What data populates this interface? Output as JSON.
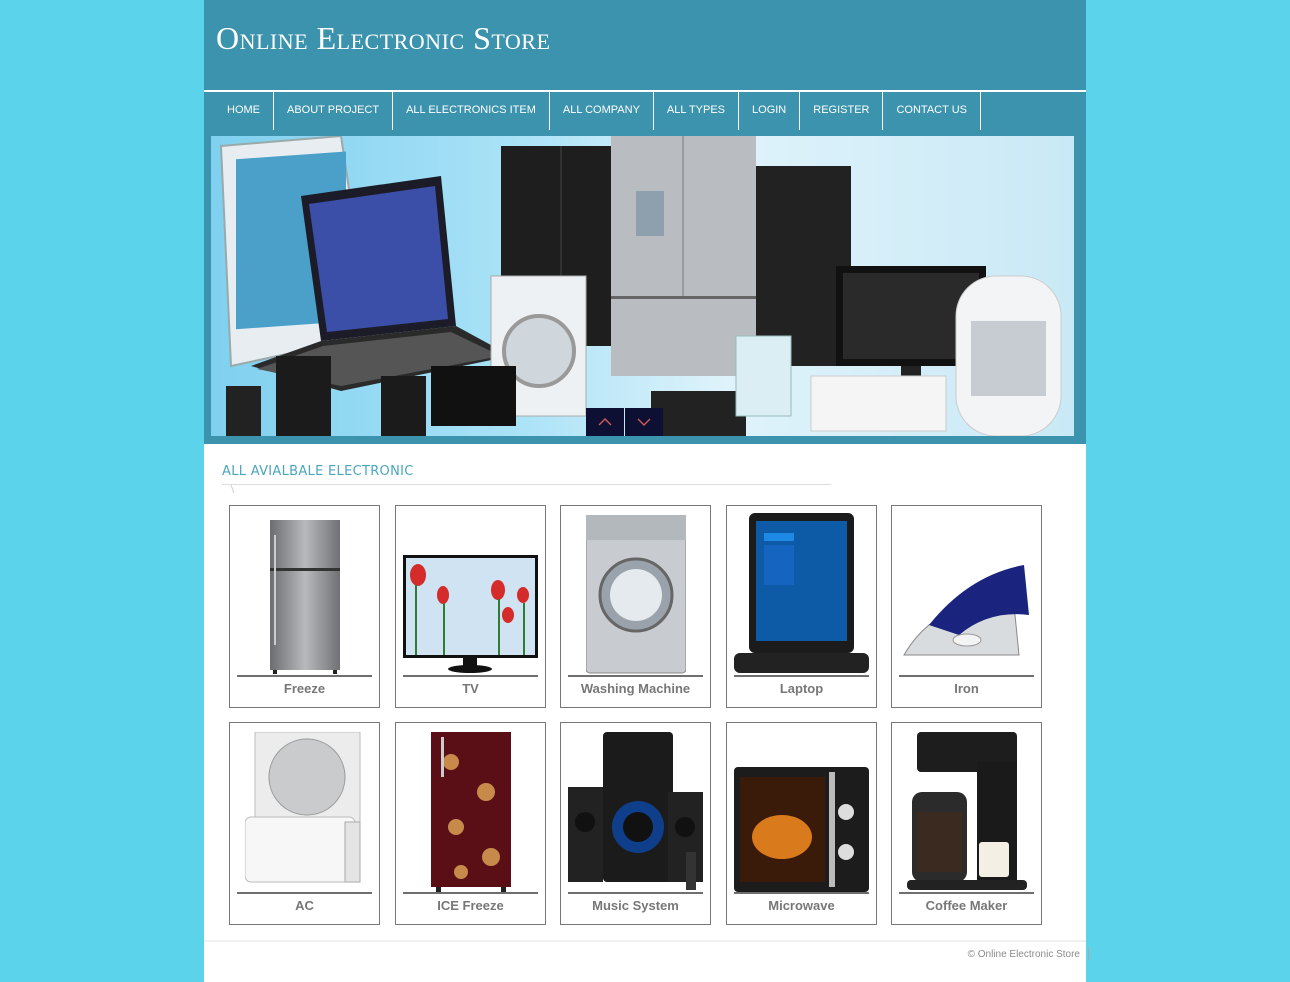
{
  "header": {
    "title": "Online Electronic Store"
  },
  "nav": {
    "items": [
      {
        "label": "HOME"
      },
      {
        "label": "ABOUT PROJECT"
      },
      {
        "label": "ALL ELECTRONICS ITEM"
      },
      {
        "label": "ALL COMPANY"
      },
      {
        "label": "ALL TYPES"
      },
      {
        "label": "LOGIN"
      },
      {
        "label": "REGISTER"
      },
      {
        "label": "CONTACT US"
      }
    ]
  },
  "banner": {
    "alt": "Assorted home electronics: laptop, refrigerators, washing machine, TV, speakers, microwave, air cooler",
    "prev_icon": "chevron-up-icon",
    "next_icon": "chevron-down-icon"
  },
  "section": {
    "title": "ALL AVIALBALE ELECTRONIC"
  },
  "products": [
    {
      "name": "Freeze",
      "icon": "refrigerator"
    },
    {
      "name": "TV",
      "icon": "television"
    },
    {
      "name": "Washing Machine",
      "icon": "washing-machine"
    },
    {
      "name": "Laptop",
      "icon": "laptop"
    },
    {
      "name": "Iron",
      "icon": "iron"
    },
    {
      "name": "AC",
      "icon": "air-conditioner"
    },
    {
      "name": "ICE Freeze",
      "icon": "single-door-refrigerator"
    },
    {
      "name": "Music System",
      "icon": "speaker-system"
    },
    {
      "name": "Microwave",
      "icon": "microwave"
    },
    {
      "name": "Coffee Maker",
      "icon": "coffee-maker"
    }
  ],
  "footer": {
    "copyright": "© Online Electronic Store"
  },
  "colors": {
    "background": "#5bd3ea",
    "header": "#3b93ad",
    "section_title": "#4aa6bd",
    "slider_button": "#0d0f33"
  }
}
